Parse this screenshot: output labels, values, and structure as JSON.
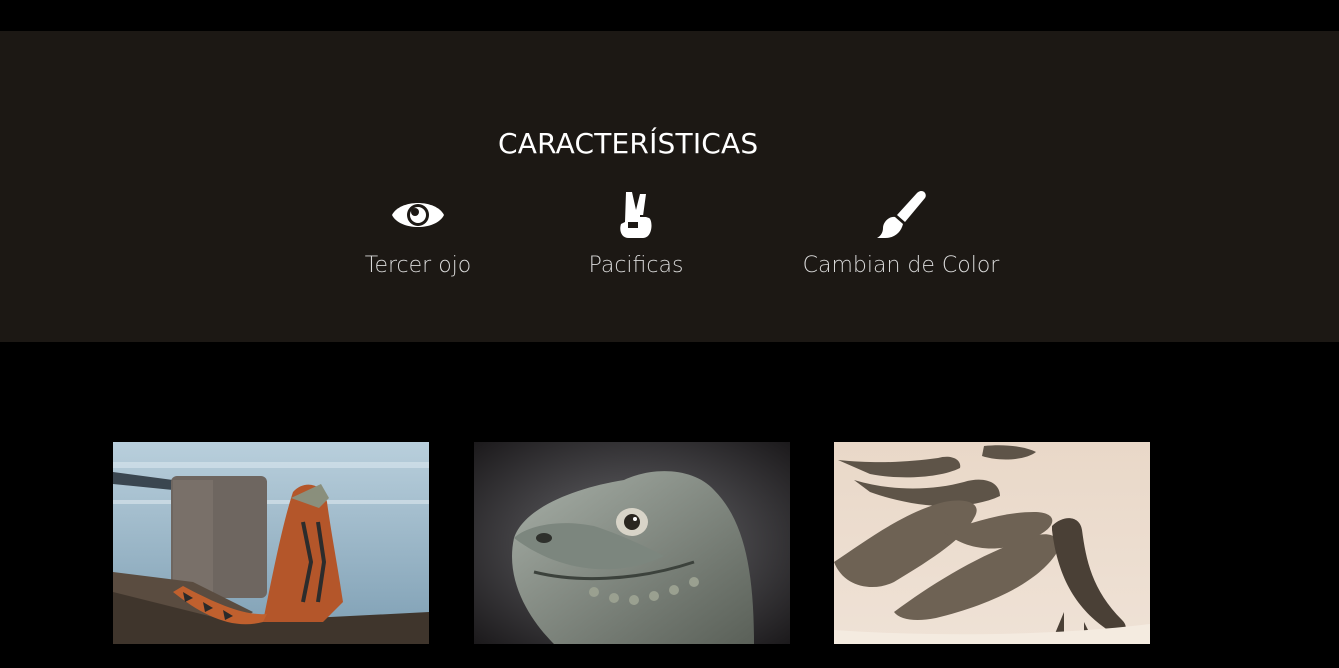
{
  "features": {
    "title": "CARACTERÍSTICAS",
    "items": [
      {
        "icon": "eye-icon",
        "label": "Tercer ojo"
      },
      {
        "icon": "peace-hand-icon",
        "label": "Pacificas"
      },
      {
        "icon": "paint-brush-icon",
        "label": "Cambian de Color"
      }
    ]
  },
  "gallery": {
    "images": [
      {
        "subject": "iguana-on-shore"
      },
      {
        "subject": "iguana-head-closeup"
      },
      {
        "subject": "iguanas-on-sand"
      }
    ]
  },
  "colors": {
    "page_background": "#000000",
    "section_background": "#1c1814",
    "title_color": "#ffffff",
    "label_color": "#d9d9d9"
  }
}
